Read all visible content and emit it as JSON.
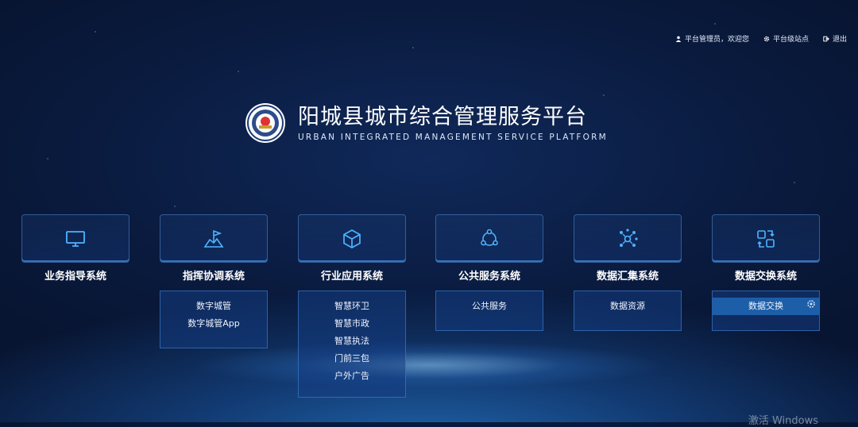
{
  "topbar": {
    "user": "平台管理员，欢迎您",
    "site": "平台级站点",
    "logout": "退出"
  },
  "header": {
    "title_cn": "阳城县城市综合管理服务平台",
    "title_en": "URBAN INTEGRATED MANAGEMENT SERVICE PLATFORM"
  },
  "systems": [
    {
      "label": "业务指导系统",
      "icon": "monitor-icon",
      "items": []
    },
    {
      "label": "指挥协调系统",
      "icon": "flag-icon",
      "items": [
        "数字城管",
        "数字城管App"
      ]
    },
    {
      "label": "行业应用系统",
      "icon": "cube-icon",
      "items": [
        "智慧环卫",
        "智慧市政",
        "智慧执法",
        "门前三包",
        "户外广告"
      ]
    },
    {
      "label": "公共服务系统",
      "icon": "network-triangle-icon",
      "items": [
        "公共服务"
      ]
    },
    {
      "label": "数据汇集系统",
      "icon": "molecule-icon",
      "items": [
        "数据资源"
      ]
    },
    {
      "label": "数据交换系统",
      "icon": "exchange-icon",
      "items": [
        "数据交换"
      ]
    }
  ],
  "colors": {
    "accent": "#4fb3ff",
    "background": "#0a1b3f"
  },
  "watermark": "激活 Windows"
}
